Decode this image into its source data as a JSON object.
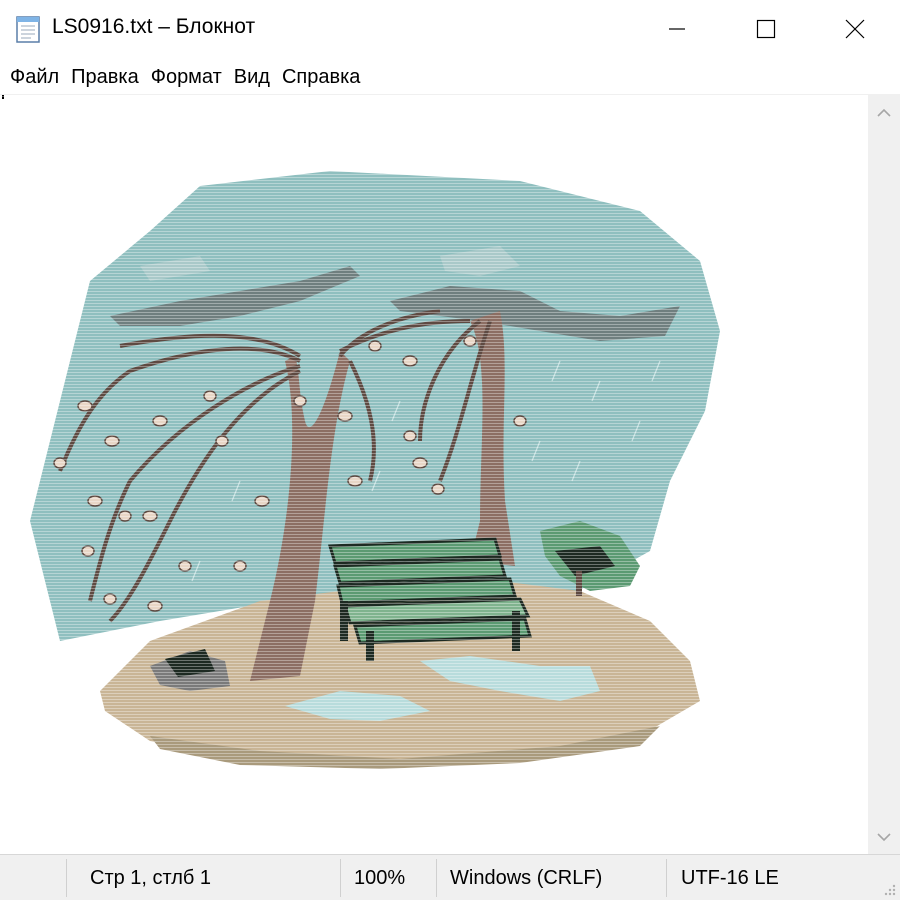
{
  "window": {
    "title": "LS0916.txt – Блокнот",
    "icon": "notepad-icon",
    "controls": [
      "minimize-icon",
      "maximize-icon",
      "close-icon"
    ]
  },
  "menu": {
    "file": "Файл",
    "edit": "Правка",
    "format": "Формат",
    "view": "Вид",
    "help": "Справка"
  },
  "editor": {
    "content_description": "ASCII/line art",
    "colors": {
      "sky": "#8fbfbf",
      "cloud": "#6f7f7f",
      "ground": "#c9b596",
      "trunk": "#8c6e63",
      "bench": "#5b9a72",
      "puddle": "#b8dcdc",
      "leaf": "#e8d6c6"
    }
  },
  "status": {
    "position": "Стр 1, стлб 1",
    "zoom": "100%",
    "line_ending": "Windows (CRLF)",
    "encoding": "UTF-16 LE"
  }
}
